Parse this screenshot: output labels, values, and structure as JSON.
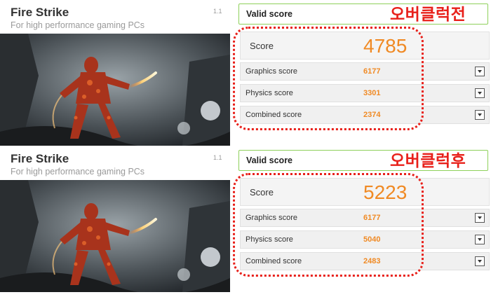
{
  "panels": [
    {
      "title": "Fire Strike",
      "subtitle": "For high performance gaming PCs",
      "version": "1.1",
      "valid_label": "Valid score",
      "annotation": "오버클럭전",
      "score_label": "Score",
      "score_value": "4785",
      "rows": [
        {
          "label": "Graphics score",
          "value": "6177"
        },
        {
          "label": "Physics score",
          "value": "3301"
        },
        {
          "label": "Combined score",
          "value": "2374"
        }
      ]
    },
    {
      "title": "Fire Strike",
      "subtitle": "For high performance gaming PCs",
      "version": "1.1",
      "valid_label": "Valid score",
      "annotation": "오버클럭후",
      "score_label": "Score",
      "score_value": "5223",
      "rows": [
        {
          "label": "Graphics score",
          "value": "6177"
        },
        {
          "label": "Physics score",
          "value": "5040"
        },
        {
          "label": "Combined score",
          "value": "2483"
        }
      ]
    }
  ],
  "colors": {
    "accent_orange": "#f08a24",
    "valid_border_green": "#8ed05a",
    "annotation_red": "#e8201a"
  },
  "icons": {
    "dropdown": "chevron-down-icon"
  }
}
